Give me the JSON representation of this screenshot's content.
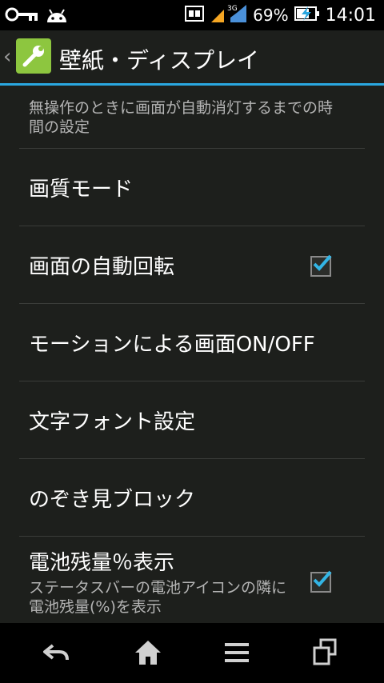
{
  "status_bar": {
    "battery_percent": "69%",
    "time": "14:01",
    "network_type": "3G",
    "icons": [
      "key-icon",
      "android-icon",
      "sim-icon",
      "signal-icon",
      "battery-charging-icon"
    ]
  },
  "action_bar": {
    "title": "壁紙・ディスプレイ",
    "back_icon": "chevron-left-icon",
    "app_icon": "wrench-icon"
  },
  "settings": {
    "items": [
      {
        "title": "",
        "summary": "無操作のときに画面が自動消灯するまでの時間の設定",
        "checkbox": null
      },
      {
        "title": "画質モード",
        "summary": "",
        "checkbox": null
      },
      {
        "title": "画面の自動回転",
        "summary": "",
        "checkbox": true
      },
      {
        "title": "モーションによる画面ON/OFF",
        "summary": "",
        "checkbox": null
      },
      {
        "title": "文字フォント設定",
        "summary": "",
        "checkbox": null
      },
      {
        "title": "のぞき見ブロック",
        "summary": "",
        "checkbox": null
      },
      {
        "title": "電池残量％表示",
        "summary": "ステータスバーの電池アイコンの隣に電池残量(%)を表示",
        "checkbox": true
      }
    ]
  },
  "nav_bar": {
    "buttons": [
      "back-icon",
      "home-icon",
      "menu-icon",
      "recent-apps-icon"
    ]
  },
  "colors": {
    "accent": "#2aa7e0",
    "background": "#1d1f1c",
    "checkmark": "#33b5e5"
  }
}
